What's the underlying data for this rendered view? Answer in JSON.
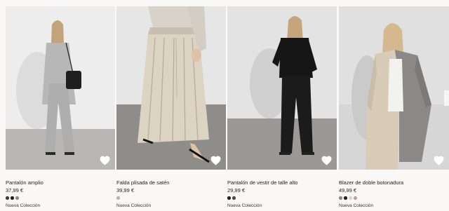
{
  "products": [
    {
      "name": "Pantalón amplio",
      "price": "37,99 €",
      "label": "Nueva Colección",
      "swatches": [
        "#3a3a3a",
        "#1e1e1e",
        "#8a8a8a"
      ]
    },
    {
      "name": "Falda plisada de satén",
      "price": "39,99 €",
      "label": "Nueva Colección",
      "swatches": [
        "#b5b5b5"
      ]
    },
    {
      "name": "Pantalón de vestir de talle alto",
      "price": "29,99 €",
      "label": "Nueva Colección",
      "swatches": [
        "#222222",
        "#4a4a4a"
      ]
    },
    {
      "name": "Blazer de doble botonadura",
      "price": "49,99 €",
      "label": "Nueva Colección",
      "swatches": [
        "#8a8a8a",
        "#1e1e1e",
        "#d7d2cc",
        "#c79aa7"
      ]
    }
  ],
  "icons": {
    "favorite": "heart-outline-icon"
  },
  "colors": {
    "background": "#faf9f8",
    "text": "#222222"
  }
}
